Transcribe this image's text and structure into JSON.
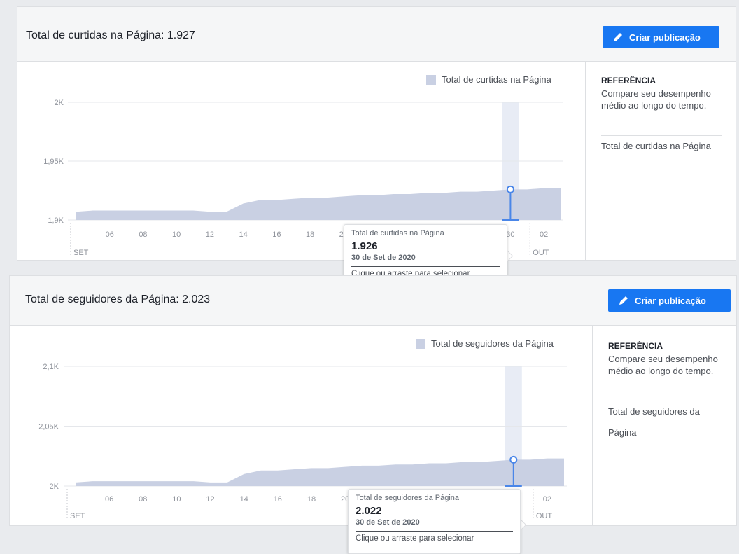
{
  "colors": {
    "accent": "#1877f2",
    "area_fill": "#c9d0e3",
    "highlight_band": "#e8ecf5",
    "marker": "#4a86e8"
  },
  "likes_card": {
    "title": "Total de curtidas na Página: 1.927",
    "create_button": "Criar publicação",
    "button_icon": "pencil-icon",
    "reference": {
      "title": "REFERÊNCIA",
      "description": "Compare seu desempenho médio ao longo do tempo.",
      "metric": "Total de curtidas na Página"
    },
    "tooltip": {
      "label": "Total de curtidas na Página",
      "value": "1.926",
      "date": "30 de Set de 2020",
      "action": "Clique ou arraste para selecionar"
    }
  },
  "followers_card": {
    "title": "Total de seguidores da Página: 2.023",
    "create_button": "Criar publicação",
    "button_icon": "pencil-icon",
    "reference": {
      "title": "REFERÊNCIA",
      "description": "Compare seu desempenho médio ao longo do tempo.",
      "metric": "Total de seguidores da Página"
    },
    "tooltip": {
      "label": "Total de seguidores da Página",
      "value": "2.022",
      "date": "30 de Set de 2020",
      "action": "Clique ou arraste para selecionar"
    }
  },
  "chart_data": [
    {
      "type": "area",
      "title": "",
      "legend": [
        "Total de curtidas na Página"
      ],
      "legend_position": "top-right",
      "grid": true,
      "ylim": [
        1900,
        2000
      ],
      "y_ticks": [
        "1,9K",
        "1,95K",
        "2K"
      ],
      "y_tick_values": [
        1900,
        1950,
        2000
      ],
      "x": [
        "2020-09-04",
        "2020-09-05",
        "2020-09-06",
        "2020-09-07",
        "2020-09-08",
        "2020-09-09",
        "2020-09-10",
        "2020-09-11",
        "2020-09-12",
        "2020-09-13",
        "2020-09-14",
        "2020-09-15",
        "2020-09-16",
        "2020-09-17",
        "2020-09-18",
        "2020-09-19",
        "2020-09-20",
        "2020-09-21",
        "2020-09-22",
        "2020-09-23",
        "2020-09-24",
        "2020-09-25",
        "2020-09-26",
        "2020-09-27",
        "2020-09-28",
        "2020-09-29",
        "2020-09-30",
        "2020-10-01",
        "2020-10-02",
        "2020-10-03"
      ],
      "x_ticks": [
        "06",
        "08",
        "10",
        "12",
        "14",
        "16",
        "18",
        "20",
        "22",
        "24",
        "26",
        "28",
        "30",
        "02"
      ],
      "x_tick_days": [
        2,
        4,
        6,
        8,
        10,
        12,
        14,
        16,
        18,
        20,
        22,
        24,
        26,
        28
      ],
      "month_labels": [
        {
          "label": "SET",
          "day": 0
        },
        {
          "label": "OUT",
          "day": 27
        }
      ],
      "series": [
        {
          "name": "Total de curtidas na Página",
          "values": [
            1907,
            1908,
            1908,
            1908,
            1908,
            1908,
            1908,
            1908,
            1907,
            1907,
            1914,
            1917,
            1917,
            1918,
            1919,
            1919,
            1920,
            1921,
            1921,
            1922,
            1922,
            1923,
            1923,
            1924,
            1924,
            1925,
            1926,
            1926,
            1927,
            1927
          ]
        }
      ],
      "highlight": {
        "date": "2020-09-30",
        "value": 1926
      }
    },
    {
      "type": "area",
      "title": "",
      "legend": [
        "Total de seguidores da Página"
      ],
      "legend_position": "top-right",
      "grid": true,
      "ylim": [
        2000,
        2100
      ],
      "y_ticks": [
        "2K",
        "2,05K",
        "2,1K"
      ],
      "y_tick_values": [
        2000,
        2050,
        2100
      ],
      "x": [
        "2020-09-04",
        "2020-09-05",
        "2020-09-06",
        "2020-09-07",
        "2020-09-08",
        "2020-09-09",
        "2020-09-10",
        "2020-09-11",
        "2020-09-12",
        "2020-09-13",
        "2020-09-14",
        "2020-09-15",
        "2020-09-16",
        "2020-09-17",
        "2020-09-18",
        "2020-09-19",
        "2020-09-20",
        "2020-09-21",
        "2020-09-22",
        "2020-09-23",
        "2020-09-24",
        "2020-09-25",
        "2020-09-26",
        "2020-09-27",
        "2020-09-28",
        "2020-09-29",
        "2020-09-30",
        "2020-10-01",
        "2020-10-02",
        "2020-10-03"
      ],
      "x_ticks": [
        "06",
        "08",
        "10",
        "12",
        "14",
        "16",
        "18",
        "20",
        "22",
        "24",
        "26",
        "28",
        "30",
        "02"
      ],
      "x_tick_days": [
        2,
        4,
        6,
        8,
        10,
        12,
        14,
        16,
        18,
        20,
        22,
        24,
        26,
        28
      ],
      "month_labels": [
        {
          "label": "SET",
          "day": 0
        },
        {
          "label": "OUT",
          "day": 27
        }
      ],
      "series": [
        {
          "name": "Total de seguidores da Página",
          "values": [
            2003,
            2004,
            2004,
            2004,
            2004,
            2004,
            2004,
            2004,
            2003,
            2003,
            2010,
            2013,
            2013,
            2014,
            2015,
            2015,
            2016,
            2017,
            2017,
            2018,
            2018,
            2019,
            2019,
            2020,
            2020,
            2021,
            2022,
            2022,
            2023,
            2023
          ]
        }
      ],
      "highlight": {
        "date": "2020-09-30",
        "value": 2022
      }
    }
  ]
}
